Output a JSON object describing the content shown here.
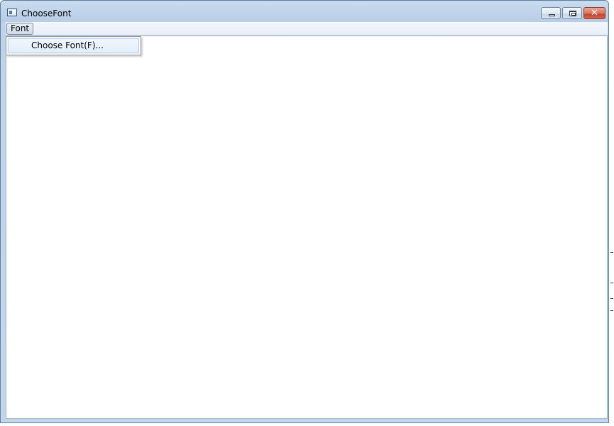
{
  "window": {
    "title": "ChooseFont",
    "icon": "application-window-icon",
    "caption_buttons": {
      "minimize": "minimize-icon",
      "maximize": "maximize-icon",
      "close": "close-icon",
      "close_glyph": "✕"
    }
  },
  "menubar": {
    "items": [
      {
        "label": "Font"
      }
    ]
  },
  "dropdown": {
    "items": [
      {
        "label": "Choose Font(F)..."
      }
    ]
  },
  "colors": {
    "title_bar": "#bfd4ea",
    "close_button": "#c4432a",
    "menu_highlight": "#e3eefb"
  }
}
